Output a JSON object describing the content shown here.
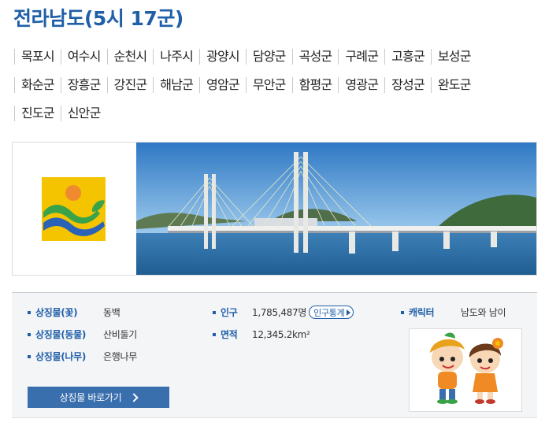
{
  "title": "전라남도(5시 17군)",
  "regions": [
    [
      "목포시",
      "여수시",
      "순천시",
      "나주시",
      "광양시",
      "담양군",
      "곡성군",
      "구례군",
      "고흥군",
      "보성군"
    ],
    [
      "화순군",
      "장흥군",
      "강진군",
      "해남군",
      "영암군",
      "무안군",
      "함평군",
      "영광군",
      "장성군",
      "완도군"
    ],
    [
      "진도군",
      "신안군"
    ]
  ],
  "images": {
    "logo": "jeollanamdo-emblem",
    "photo": "cable-stayed-bridge-over-sea",
    "characters": "mascot-characters"
  },
  "info": {
    "flower_label": "상징물(꽃)",
    "flower_value": "동백",
    "animal_label": "상징물(동물)",
    "animal_value": "산비둘기",
    "tree_label": "상징물(나무)",
    "tree_value": "은행나무",
    "population_label": "인구",
    "population_value": "1,785,487명",
    "population_stats_button": "인구통계",
    "area_label": "면적",
    "area_value": "12,345.2km²",
    "character_label": "캐릭터",
    "character_value": "남도와 남이",
    "go_button": "상징물 바로가기"
  },
  "colors": {
    "accent": "#1f5fa8",
    "button": "#3a6fae",
    "logo_yellow": "#f5c400",
    "logo_sun": "#ef8a2f",
    "logo_green": "#3aa34a",
    "logo_blue": "#2a62b8"
  }
}
